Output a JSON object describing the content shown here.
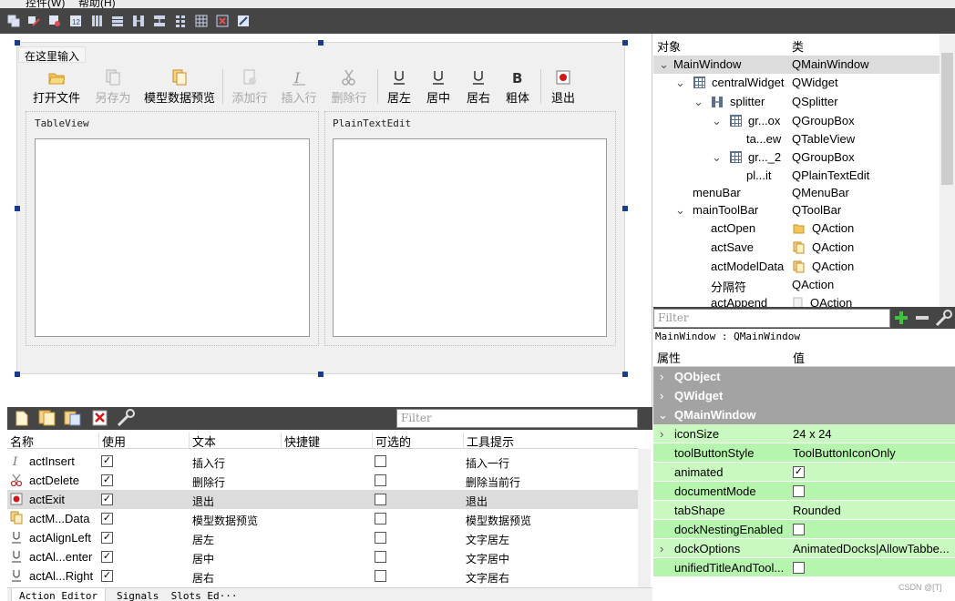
{
  "menu": {
    "controls": "控件(W)",
    "help": "帮助(H)"
  },
  "form": {
    "type_here": "在这里输入",
    "toolbar": [
      {
        "label": "打开文件",
        "icon": "folder-open-icon",
        "enabled": true
      },
      {
        "label": "另存为",
        "icon": "copy-icon",
        "enabled": false
      },
      {
        "label": "模型数据预览",
        "icon": "copy-icon",
        "enabled": true
      },
      {
        "label": "添加行",
        "icon": "add-doc-icon",
        "enabled": false
      },
      {
        "label": "插入行",
        "icon": "italic-icon",
        "enabled": false
      },
      {
        "label": "删除行",
        "icon": "scissors-icon",
        "enabled": false
      },
      {
        "label": "居左",
        "icon": "underline-icon",
        "enabled": true
      },
      {
        "label": "居中",
        "icon": "underline-icon",
        "enabled": true
      },
      {
        "label": "居右",
        "icon": "underline-icon",
        "enabled": true
      },
      {
        "label": "粗体",
        "icon": "bold-icon",
        "enabled": true
      },
      {
        "label": "退出",
        "icon": "record-icon",
        "enabled": true
      }
    ],
    "group_tableview": "TableView",
    "group_plaintext": "PlainTextEdit"
  },
  "action_editor": {
    "filter_placeholder": "Filter",
    "columns": [
      "名称",
      "使用",
      "文本",
      "快捷键",
      "可选的",
      "工具提示"
    ],
    "rows": [
      {
        "name": "actInsert",
        "icon": "italic-icon",
        "used": true,
        "text": "插入行",
        "shortcut": "",
        "checkable": false,
        "tooltip": "插入一行"
      },
      {
        "name": "actDelete",
        "icon": "scissors-icon",
        "used": true,
        "text": "删除行",
        "shortcut": "",
        "checkable": false,
        "tooltip": "删除当前行"
      },
      {
        "name": "actExit",
        "icon": "record-icon",
        "used": true,
        "text": "退出",
        "shortcut": "",
        "checkable": false,
        "tooltip": "退出"
      },
      {
        "name": "actM...Data",
        "icon": "copy-icon",
        "used": true,
        "text": "模型数据预览",
        "shortcut": "",
        "checkable": false,
        "tooltip": "模型数据预览"
      },
      {
        "name": "actAlignLeft",
        "icon": "underline-icon",
        "used": true,
        "text": "居左",
        "shortcut": "",
        "checkable": false,
        "tooltip": "文字居左"
      },
      {
        "name": "actAl...enter",
        "icon": "underline-icon",
        "used": true,
        "text": "居中",
        "shortcut": "",
        "checkable": false,
        "tooltip": "文字居中"
      },
      {
        "name": "actAl...Right",
        "icon": "underline-icon",
        "used": true,
        "text": "居右",
        "shortcut": "",
        "checkable": false,
        "tooltip": "文字居右"
      }
    ],
    "selected_row": 2,
    "tabs": [
      "Action Editor",
      "Signals _Slots Ed···"
    ]
  },
  "object_inspector": {
    "col_object": "对象",
    "col_class": "类",
    "rows": [
      {
        "name": "MainWindow",
        "cls": "QMainWindow"
      },
      {
        "name": "centralWidget",
        "cls": "QWidget"
      },
      {
        "name": "splitter",
        "cls": "QSplitter"
      },
      {
        "name": "gr...ox",
        "cls": "QGroupBox"
      },
      {
        "name": "ta...ew",
        "cls": "QTableView"
      },
      {
        "name": "gr..._2",
        "cls": "QGroupBox"
      },
      {
        "name": "pl...it",
        "cls": "QPlainTextEdit"
      },
      {
        "name": "menuBar",
        "cls": "QMenuBar"
      },
      {
        "name": "mainToolBar",
        "cls": "QToolBar"
      },
      {
        "name": "actOpen",
        "cls": "QAction"
      },
      {
        "name": "actSave",
        "cls": "QAction"
      },
      {
        "name": "actModelData",
        "cls": "QAction"
      },
      {
        "name": "分隔符",
        "cls": "QAction"
      },
      {
        "name": "actAppend",
        "cls": "QAction"
      }
    ]
  },
  "property_editor": {
    "filter_placeholder": "Filter",
    "object_label": "MainWindow : QMainWindow",
    "col_property": "属性",
    "col_value": "值",
    "categories": [
      "QObject",
      "QWidget",
      "QMainWindow"
    ],
    "rows": [
      {
        "name": "iconSize",
        "value": "24 x 24",
        "expandable": true
      },
      {
        "name": "toolButtonStyle",
        "value": "ToolButtonIconOnly",
        "expandable": false
      },
      {
        "name": "animated",
        "value": "",
        "checked": true
      },
      {
        "name": "documentMode",
        "value": "",
        "checked": false
      },
      {
        "name": "tabShape",
        "value": "Rounded",
        "expandable": false
      },
      {
        "name": "dockNestingEnabled",
        "value": "",
        "checked": false
      },
      {
        "name": "dockOptions",
        "value": "AnimatedDocks|AllowTabbe...",
        "expandable": true
      },
      {
        "name": "unifiedTitleAndTool...",
        "value": "",
        "checked": false
      }
    ]
  },
  "watermark": "CSDN @[T]",
  "colors": {
    "dark_toolbar": "#454545",
    "prop_green": "#c9f8c0",
    "prop_green_alt": "#b6f5ad",
    "category_gray": "#a3a3a3",
    "selected_row": "#dcdcdc"
  }
}
